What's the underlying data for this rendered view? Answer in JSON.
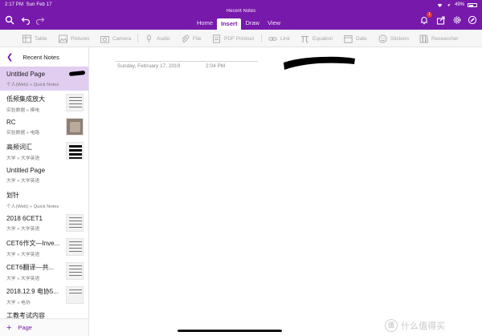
{
  "status_bar": {
    "time": "2:17 PM",
    "date": "Sun Feb 17",
    "battery": "49%"
  },
  "window_title": "Recent Notes",
  "ribbon_tabs": [
    {
      "label": "Home",
      "active": false
    },
    {
      "label": "Insert",
      "active": true
    },
    {
      "label": "Draw",
      "active": false
    },
    {
      "label": "View",
      "active": false
    }
  ],
  "header": {
    "notification_count": "1"
  },
  "toolbar": {
    "table": "Table",
    "pictures": "Pictures",
    "camera": "Camera",
    "audio": "Audio",
    "file": "File",
    "pdf_printout": "PDF Printout",
    "link": "Link",
    "equation": "Equation",
    "date": "Date",
    "stickers": "Stickers",
    "researcher": "Researcher"
  },
  "sidebar": {
    "title": "Recent Notes",
    "add_label": "Page",
    "items": [
      {
        "name": "Untitled Page",
        "location": "个人(Web) » Quick Notes"
      },
      {
        "name": "低频集成放大",
        "location": "实验数据 » 模电"
      },
      {
        "name": "RC",
        "location": "实验数据 » 电路"
      },
      {
        "name": "高频词汇",
        "location": "大学 » 大学英语"
      },
      {
        "name": "Untitled Page",
        "location": "大学 » 大学英语"
      },
      {
        "name": "划针",
        "location": "个人(Web) » Quick Notes"
      },
      {
        "name": "2018 6CET1",
        "location": "大学 » 大学英语"
      },
      {
        "name": "CET6作文—Inve...",
        "location": "大学 » 大学英语"
      },
      {
        "name": "CET6翻译—共...",
        "location": "大学 » 大学英语"
      },
      {
        "name": "2018.12.9 电协5...",
        "location": "大学 » 电协"
      },
      {
        "name": "工教考试内容",
        "location": ""
      }
    ]
  },
  "page": {
    "date": "Sunday, February 17, 2019",
    "time": "2:04 PM"
  },
  "watermark": {
    "text": "什么值得买",
    "badge": "值"
  }
}
